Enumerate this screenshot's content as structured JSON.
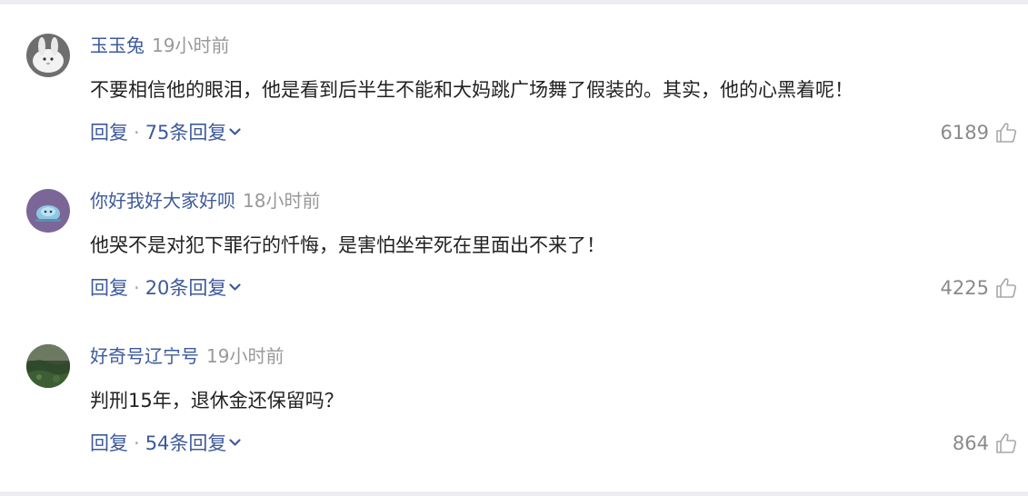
{
  "comments": [
    {
      "username": "玉玉兔",
      "time": "19小时前",
      "content": "不要相信他的眼泪，他是看到后半生不能和大妈跳广场舞了假装的。其实，他的心黑着呢！",
      "reply_label": "回复",
      "separator": "·",
      "replies_label": "75条回复",
      "likes": "6189",
      "avatar_icon": "rabbit-avatar-icon"
    },
    {
      "username": "你好我好大家好呗",
      "time": "18小时前",
      "content": "他哭不是对犯下罪行的忏悔，是害怕坐牢死在里面出不来了！",
      "reply_label": "回复",
      "separator": "·",
      "replies_label": "20条回复",
      "likes": "4225",
      "avatar_icon": "alien-avatar-icon"
    },
    {
      "username": "好奇号辽宁号",
      "time": "19小时前",
      "content": "判刑15年，退休金还保留吗？",
      "reply_label": "回复",
      "separator": "·",
      "replies_label": "54条回复",
      "likes": "864",
      "avatar_icon": "landscape-avatar-icon"
    }
  ],
  "colors": {
    "username": "#3d5a9b",
    "link": "#3d5a9b",
    "time": "#999999",
    "content": "#222222",
    "like_count": "#8a8a8a",
    "page_background": "#eceef1"
  }
}
